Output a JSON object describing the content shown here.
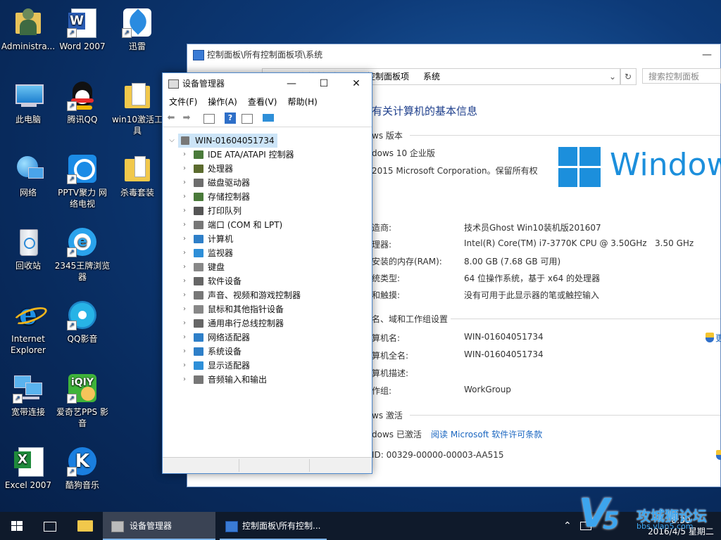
{
  "desktop_icons": [
    {
      "label": "Administra...",
      "icon": "user-folder-icon"
    },
    {
      "label": "Word 2007",
      "icon": "word-icon"
    },
    {
      "label": "迅雷",
      "icon": "xunlei-icon"
    },
    {
      "label": "此电脑",
      "icon": "computer-icon"
    },
    {
      "label": "腾讯QQ",
      "icon": "qq-icon"
    },
    {
      "label": "win10激活工具",
      "icon": "folder-icon"
    },
    {
      "label": "网络",
      "icon": "network-icon"
    },
    {
      "label": "PPTV聚力 网络电视",
      "icon": "pptv-icon"
    },
    {
      "label": "杀毒套装",
      "icon": "folder-icon"
    },
    {
      "label": "回收站",
      "icon": "recycle-bin-icon"
    },
    {
      "label": "2345王牌浏览器",
      "icon": "browser-2345-icon"
    },
    {
      "label": "Internet Explorer",
      "icon": "ie-icon"
    },
    {
      "label": "QQ影音",
      "icon": "qqplayer-icon"
    },
    {
      "label": "宽带连接",
      "icon": "broadband-icon"
    },
    {
      "label": "爱奇艺PPS 影音",
      "icon": "iqiyi-icon"
    },
    {
      "label": "Excel 2007",
      "icon": "excel-icon"
    },
    {
      "label": "酷狗音乐",
      "icon": "kugou-icon"
    }
  ],
  "control_panel": {
    "title": "控制面板\\所有控制面板项\\系统",
    "address_part1": "控制面板项",
    "address_part2": "系统",
    "address_part0": "所有控制面板项",
    "search_placeholder": "搜索控制面板",
    "heading": "有关计算机的基本信息",
    "section_edition": "ws 版本",
    "edition": "dows 10 企业版",
    "copyright": "2015 Microsoft Corporation。保留所有权",
    "windows_logo_text": "Windows",
    "rows": [
      {
        "label": "造商:",
        "value": "技术员Ghost Win10装机版201607"
      },
      {
        "label": "理器:",
        "value": "Intel(R) Core(TM) i7-3770K CPU @ 3.50GHz   3.50 GHz"
      },
      {
        "label": "安装的内存(RAM):",
        "value": "8.00 GB (7.68 GB 可用)"
      },
      {
        "label": "统类型:",
        "value": "64 位操作系统，基于 x64 的处理器"
      },
      {
        "label": "和触摸:",
        "value": "没有可用于此显示器的笔或触控输入"
      }
    ],
    "section_computer": "名、域和工作组设置",
    "computer_rows": [
      {
        "label": "算机名:",
        "value": "WIN-01604051734"
      },
      {
        "label": "算机全名:",
        "value": "WIN-01604051734"
      },
      {
        "label": "算机描述:",
        "value": ""
      },
      {
        "label": "作组:",
        "value": "WorkGroup"
      }
    ],
    "change_settings": "更",
    "section_activation": "ws 激活",
    "activation_status": "dows 已激活",
    "license_link": "阅读 Microsoft 软件许可条款",
    "product_id": "ID: 00329-00000-00003-AA515"
  },
  "device_manager": {
    "title": "设备管理器",
    "menu": [
      "文件(F)",
      "操作(A)",
      "查看(V)",
      "帮助(H)"
    ],
    "root": "WIN-01604051734",
    "nodes": [
      {
        "label": "IDE ATA/ATAPI 控制器",
        "color": "#4a7a3a"
      },
      {
        "label": "处理器",
        "color": "#5c6b2e"
      },
      {
        "label": "磁盘驱动器",
        "color": "#6d6d6d"
      },
      {
        "label": "存储控制器",
        "color": "#4a7a3a"
      },
      {
        "label": "打印队列",
        "color": "#555555"
      },
      {
        "label": "端口 (COM 和 LPT)",
        "color": "#777777"
      },
      {
        "label": "计算机",
        "color": "#2e7fc8"
      },
      {
        "label": "监视器",
        "color": "#2e8fd8"
      },
      {
        "label": "键盘",
        "color": "#888888"
      },
      {
        "label": "软件设备",
        "color": "#666666"
      },
      {
        "label": "声音、视频和游戏控制器",
        "color": "#777777"
      },
      {
        "label": "鼠标和其他指针设备",
        "color": "#888888"
      },
      {
        "label": "通用串行总线控制器",
        "color": "#666666"
      },
      {
        "label": "网络适配器",
        "color": "#2e7fc8"
      },
      {
        "label": "系统设备",
        "color": "#2e7fc8"
      },
      {
        "label": "显示适配器",
        "color": "#2e8fd8"
      },
      {
        "label": "音频输入和输出",
        "color": "#777777"
      }
    ]
  },
  "taskbar": {
    "task1": "设备管理器",
    "task2": "控制面板\\所有控制...",
    "date": "2016/4/5 星期二",
    "time": "8:30"
  },
  "watermark": {
    "brand": "攻城狮论坛",
    "url": "bbs.vlan5.com"
  }
}
